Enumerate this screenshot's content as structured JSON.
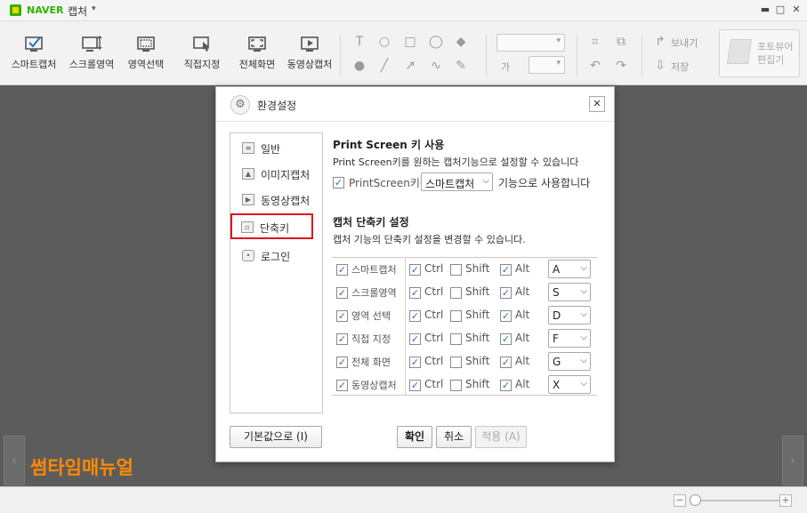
{
  "app": {
    "brand": "NAVER",
    "name": "캡처",
    "menu_arrow": "▾",
    "win_minimize": "▬",
    "win_restore": "□",
    "win_close": "✕"
  },
  "toolbar": {
    "tools": [
      {
        "name": "smart-capture",
        "label": "스마트캡처",
        "icon": "smart-capture-icon"
      },
      {
        "name": "scroll-region",
        "label": "스크롤영역",
        "icon": "scroll-capture-icon"
      },
      {
        "name": "region-select",
        "label": "영역선택",
        "icon": "region-select-icon"
      },
      {
        "name": "direct-select",
        "label": "직접지정",
        "icon": "direct-select-icon"
      },
      {
        "name": "full-screen",
        "label": "전체화면",
        "icon": "fullscreen-icon"
      },
      {
        "name": "video-capture",
        "label": "동영상캡처",
        "icon": "video-capture-icon"
      }
    ],
    "text_size_label": "가",
    "send_label": "보내기",
    "save_label": "저장",
    "editor_label_line1": "포토뷰어",
    "editor_label_line2": "편집기"
  },
  "watermark": "썸타임매뉴얼",
  "dialog": {
    "title": "환경설정",
    "close_glyph": "✕",
    "sidebar": [
      {
        "name": "general",
        "label": "일반",
        "active": false
      },
      {
        "name": "image-capture",
        "label": "이미지캡처",
        "active": false
      },
      {
        "name": "video-capture",
        "label": "동영상캡처",
        "active": false
      },
      {
        "name": "shortcut",
        "label": "단축키",
        "active": true
      },
      {
        "name": "login",
        "label": "로그인",
        "active": false
      }
    ],
    "printscreen": {
      "title": "Print Screen 키 사용",
      "desc": "Print Screen키를 원하는 캡처기능으로 설정할 수 있습니다",
      "checkbox_label": "PrintScreen키를",
      "selected": "스마트캡처",
      "suffix": "기능으로 사용합니다",
      "checked": true
    },
    "shortcuts": {
      "title": "캡처 단축키 설정",
      "desc": "캡처 기능의 단축키 설정을 변경할 수 있습니다.",
      "ctrl_label": "Ctrl",
      "shift_label": "Shift",
      "alt_label": "Alt",
      "rows": [
        {
          "label": "스마트캡처",
          "enabled": true,
          "ctrl": true,
          "shift": false,
          "alt": true,
          "key": "A"
        },
        {
          "label": "스크롤영역",
          "enabled": true,
          "ctrl": true,
          "shift": false,
          "alt": true,
          "key": "S"
        },
        {
          "label": "영역 선택",
          "enabled": true,
          "ctrl": true,
          "shift": false,
          "alt": true,
          "key": "D"
        },
        {
          "label": "직접 지정",
          "enabled": true,
          "ctrl": true,
          "shift": false,
          "alt": true,
          "key": "F"
        },
        {
          "label": "전체 화면",
          "enabled": true,
          "ctrl": true,
          "shift": false,
          "alt": true,
          "key": "G"
        },
        {
          "label": "동영상캡처",
          "enabled": true,
          "ctrl": true,
          "shift": false,
          "alt": true,
          "key": "X"
        }
      ]
    },
    "buttons": {
      "defaults": "기본값으로 (I)",
      "ok": "확인",
      "cancel": "취소",
      "apply": "적용 (A)"
    }
  },
  "statusbar": {
    "zoom_out": "−",
    "zoom_in": "+"
  },
  "colors": {
    "accent_check": "#2b6cc2",
    "active_highlight": "#e0141e",
    "watermark": "#ff8a00",
    "naver_green": "#2db400"
  }
}
